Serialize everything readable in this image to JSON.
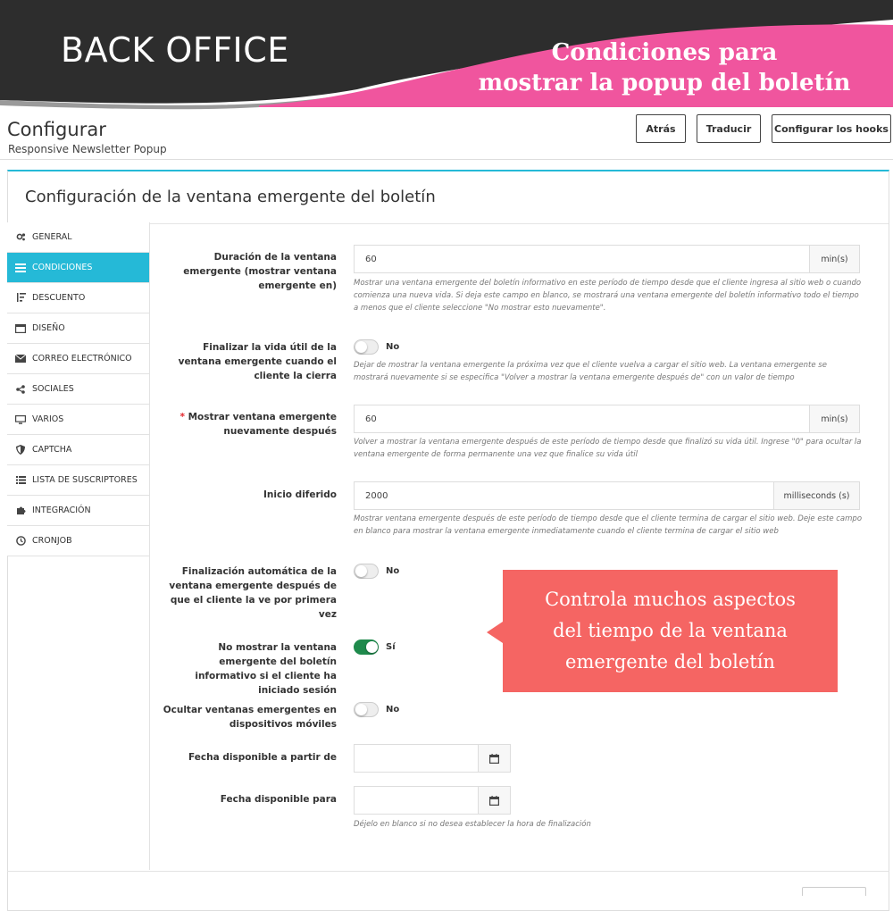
{
  "banner": {
    "left_title": "BACK OFFICE",
    "right_line1": "Condiciones para",
    "right_line2": "mostrar la popup del boletín",
    "colors": {
      "dark": "#2b2b2b",
      "pink": "#f0559e"
    }
  },
  "header": {
    "title": "Configurar",
    "subtitle": "Responsive Newsletter Popup",
    "buttons": {
      "back": "Atrás",
      "translate": "Traducir",
      "hooks": "Configurar los hooks"
    }
  },
  "panel": {
    "title": "Configuración de la ventana emergente del boletín"
  },
  "sidebar": {
    "items": [
      {
        "label": "GENERAL",
        "icon": "gears-icon"
      },
      {
        "label": "CONDICIONES",
        "icon": "list-icon",
        "active": true
      },
      {
        "label": "DESCUENTO",
        "icon": "sort-icon"
      },
      {
        "label": "DISEÑO",
        "icon": "window-icon"
      },
      {
        "label": "CORREO ELECTRÓNICO",
        "icon": "envelope-icon"
      },
      {
        "label": "SOCIALES",
        "icon": "share-icon"
      },
      {
        "label": "VARIOS",
        "icon": "monitor-icon"
      },
      {
        "label": "CAPTCHA",
        "icon": "shield-icon"
      },
      {
        "label": "LISTA DE SUSCRIPTORES",
        "icon": "list-icon"
      },
      {
        "label": "INTEGRACIÓN",
        "icon": "puzzle-icon"
      },
      {
        "label": "CRONJOB",
        "icon": "clock-icon"
      }
    ]
  },
  "form": {
    "duration": {
      "label": "Duración de la ventana emergente (mostrar ventana emergente en)",
      "value": "60",
      "unit": "min(s)",
      "help": "Mostrar una ventana emergente del boletín informativo en este período de tiempo desde que el cliente ingresa al sitio web o cuando comienza una nueva vida. Si deja este campo en blanco, se mostrará una ventana emergente del boletín informativo todo el tiempo a menos que el cliente seleccione \"No mostrar esto nuevamente\"."
    },
    "end_on_close": {
      "label": "Finalizar la vida útil de la ventana emergente cuando el cliente la cierra",
      "state": "No",
      "help": "Dejar de mostrar la ventana emergente la próxima vez que el cliente vuelva a cargar el sitio web. La ventana emergente se mostrará nuevamente si se especifica \"Volver a mostrar la ventana emergente después de\" con un valor de tiempo"
    },
    "show_again": {
      "required_mark": "*",
      "label": "Mostrar ventana emergente nuevamente después",
      "value": "60",
      "unit": "min(s)",
      "help": "Volver a mostrar la ventana emergente después de este período de tiempo desde que finalizó su vida útil. Ingrese \"0\" para ocultar la ventana emergente de forma permanente una vez que finalice su vida útil"
    },
    "delay": {
      "label": "Inicio diferido",
      "value": "2000",
      "unit": "milliseconds (s)",
      "help": "Mostrar ventana emergente después de este período de tiempo desde que el cliente termina de cargar el sitio web. Deje este campo en blanco para mostrar la ventana emergente inmediatamente cuando el cliente termina de cargar el sitio web"
    },
    "auto_end": {
      "label": "Finalización automática de la ventana emergente después de que el cliente la ve por primera vez",
      "state": "No"
    },
    "hide_logged": {
      "label": "No mostrar la ventana emergente del boletín informativo si el cliente ha iniciado sesión",
      "state": "Sí"
    },
    "hide_mobile": {
      "label": "Ocultar ventanas emergentes en dispositivos móviles",
      "state": "No"
    },
    "date_from": {
      "label": "Fecha disponible a partir de"
    },
    "date_to": {
      "label": "Fecha disponible para",
      "help": "Déjelo en blanco si no desea establecer la hora de finalización"
    }
  },
  "callout": {
    "line1": "Controla muchos aspectos",
    "line2": "del tiempo de la ventana",
    "line3": "emergente del boletín",
    "color": "#f56563"
  },
  "accent": "#25b9d7"
}
